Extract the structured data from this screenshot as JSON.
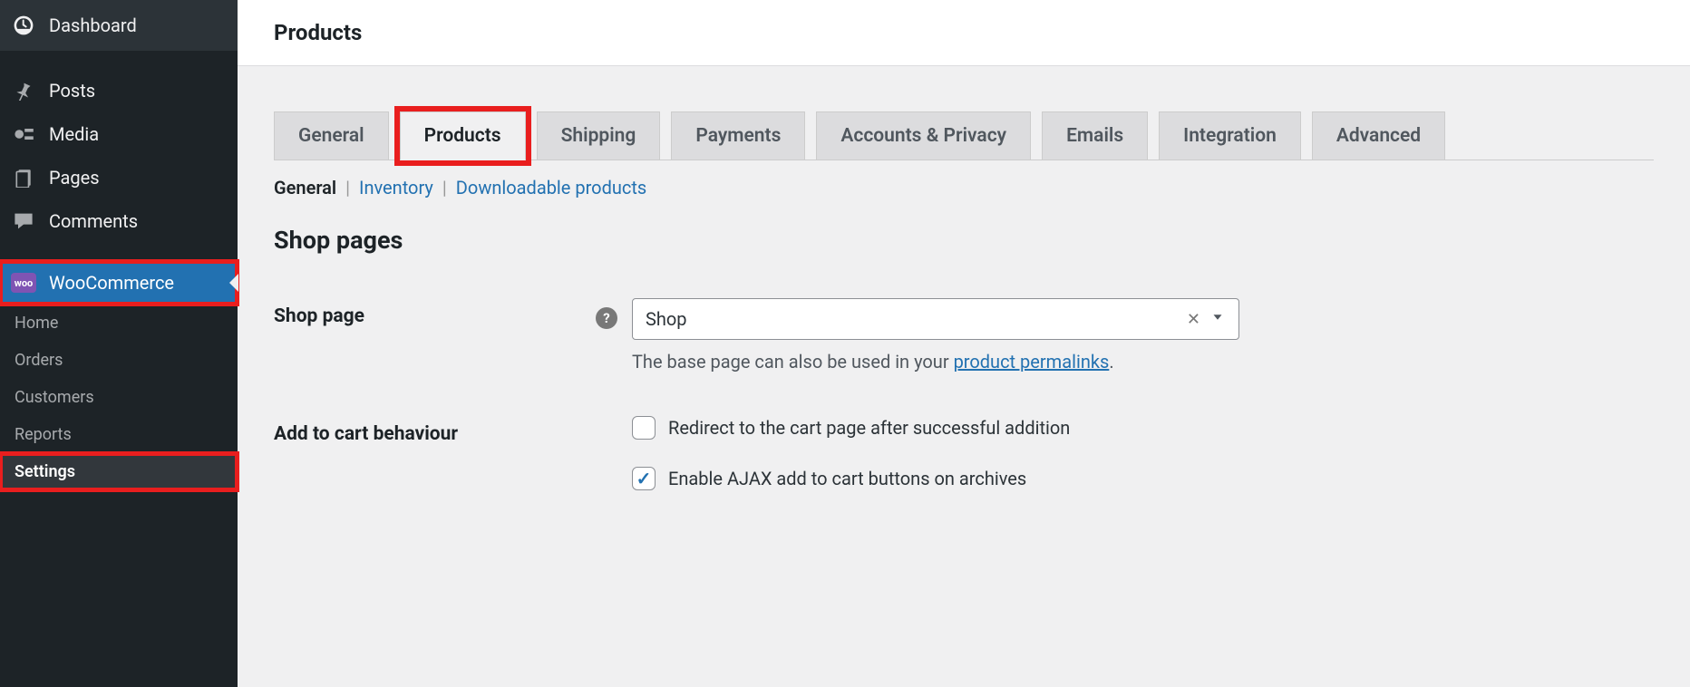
{
  "sidebar": {
    "dashboard": "Dashboard",
    "posts": "Posts",
    "media": "Media",
    "pages": "Pages",
    "comments": "Comments",
    "woocommerce": "WooCommerce",
    "home": "Home",
    "orders": "Orders",
    "customers": "Customers",
    "reports": "Reports",
    "settings": "Settings"
  },
  "page": {
    "title": "Products"
  },
  "tabs": {
    "general": "General",
    "products": "Products",
    "shipping": "Shipping",
    "payments": "Payments",
    "accounts": "Accounts & Privacy",
    "emails": "Emails",
    "integration": "Integration",
    "advanced": "Advanced"
  },
  "subtabs": {
    "general": "General",
    "inventory": "Inventory",
    "downloadable": "Downloadable products"
  },
  "section": {
    "shop_pages": "Shop pages",
    "shop_page_label": "Shop page",
    "shop_page_value": "Shop",
    "shop_page_hint": "The base page can also be used in your ",
    "shop_page_hint_link": "product permalinks",
    "add_to_cart_label": "Add to cart behaviour",
    "cb_redirect": "Redirect to the cart page after successful addition",
    "cb_ajax": "Enable AJAX add to cart buttons on archives"
  }
}
